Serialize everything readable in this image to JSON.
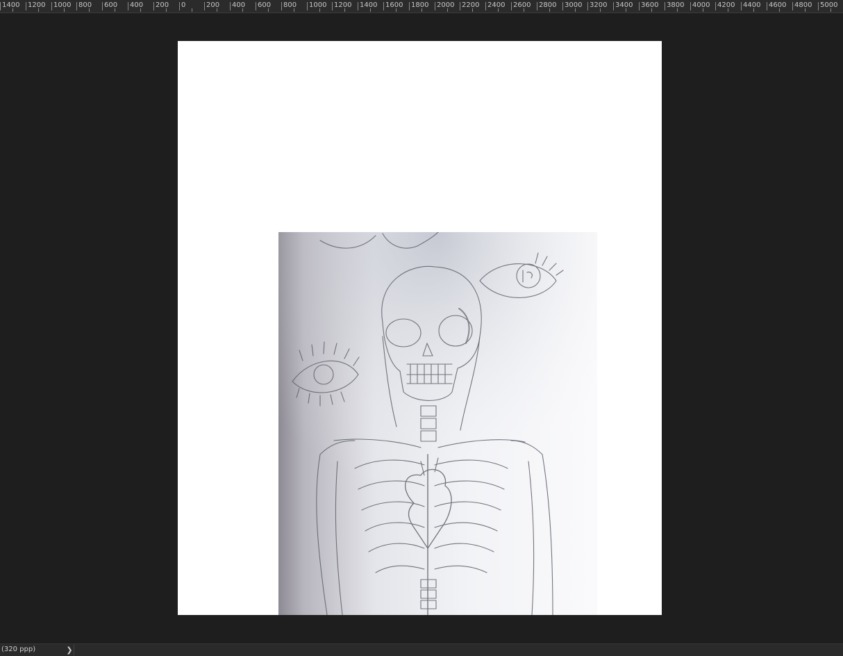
{
  "ruler": {
    "labels": [
      "1400",
      "1200",
      "1000",
      "800",
      "600",
      "400",
      "200",
      "0",
      "200",
      "400",
      "600",
      "800",
      "1000",
      "1200",
      "1400",
      "1600",
      "1800",
      "2000",
      "2200",
      "2400",
      "2600",
      "2800",
      "3000",
      "3200",
      "3400",
      "3600",
      "3800",
      "4000",
      "4200",
      "4400",
      "4600",
      "4800",
      "5000"
    ]
  },
  "document": {
    "image_subject": "pencil sketch of a skeleton with a heart and eyes"
  },
  "statusbar": {
    "zoom_text": "(320 ppp)",
    "expand_icon": "chevron-right-icon",
    "expand_glyph": "❯"
  }
}
